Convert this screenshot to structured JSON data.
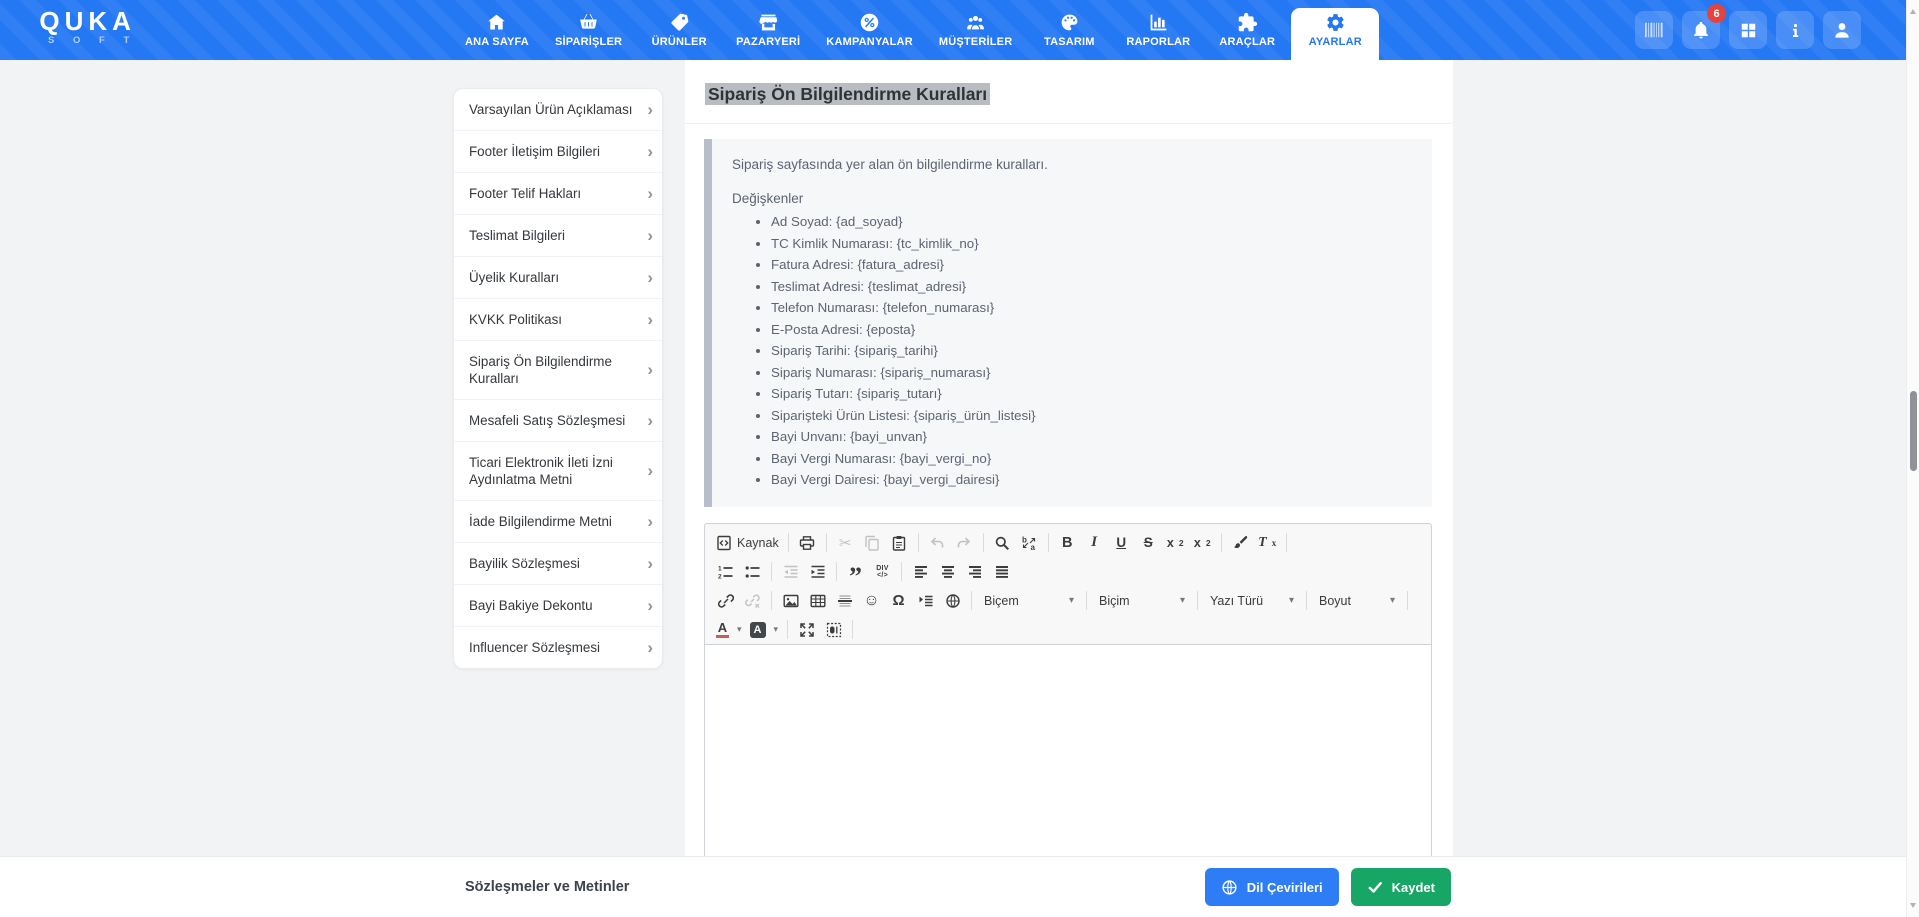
{
  "brand": {
    "name": "QUKA",
    "sub": "S O F T"
  },
  "colors": {
    "accent_blue": "#2277f2",
    "success_green": "#17a666",
    "badge_red": "#e5433e",
    "info_box_bar": "#b7bdca"
  },
  "header": {
    "notifications_badge": "6",
    "nav": [
      {
        "label": "ANA SAYFA",
        "icon": "home-icon",
        "active": false
      },
      {
        "label": "SİPARİŞLER",
        "icon": "basket-icon",
        "active": false
      },
      {
        "label": "ÜRÜNLER",
        "icon": "tag-icon",
        "active": false
      },
      {
        "label": "PAZARYERİ",
        "icon": "store-icon",
        "active": false
      },
      {
        "label": "KAMPANYALAR",
        "icon": "percent-icon",
        "active": false
      },
      {
        "label": "MÜŞTERİLER",
        "icon": "users-icon",
        "active": false
      },
      {
        "label": "TASARIM",
        "icon": "palette-icon",
        "active": false
      },
      {
        "label": "RAPORLAR",
        "icon": "chart-icon",
        "active": false
      },
      {
        "label": "ARAÇLAR",
        "icon": "puzzle-icon",
        "active": false
      },
      {
        "label": "AYARLAR",
        "icon": "gear-icon",
        "active": true
      }
    ],
    "actions": [
      {
        "icon": "barcode-icon"
      },
      {
        "icon": "bell-icon",
        "badge": "6"
      },
      {
        "icon": "grid-icon"
      },
      {
        "icon": "info-icon"
      },
      {
        "icon": "user-icon"
      }
    ]
  },
  "sidebar": {
    "items": [
      "Varsayılan Ürün Açıklaması",
      "Footer İletişim Bilgileri",
      "Footer Telif Hakları",
      "Teslimat Bilgileri",
      "Üyelik Kuralları",
      "KVKK Politikası",
      "Sipariş Ön Bilgilendirme Kuralları",
      "Mesafeli Satış Sözleşmesi",
      "Ticari Elektronik İleti İzni Aydınlatma Metni",
      "İade Bilgilendirme Metni",
      "Bayilik Sözleşmesi",
      "Bayi Bakiye Dekontu",
      "Influencer Sözleşmesi"
    ]
  },
  "content": {
    "title": "Sipariş Ön Bilgilendirme Kuralları",
    "info": {
      "intro": "Sipariş sayfasında yer alan ön bilgilendirme kuralları.",
      "variables_heading": "Değişkenler",
      "variables": [
        "Ad Soyad: {ad_soyad}",
        "TC Kimlik Numarası: {tc_kimlik_no}",
        "Fatura Adresi: {fatura_adresi}",
        "Teslimat Adresi: {teslimat_adresi}",
        "Telefon Numarası: {telefon_numarası}",
        "E-Posta Adresi: {eposta}",
        "Sipariş Tarihi: {sipariş_tarihi}",
        "Sipariş Numarası: {sipariş_numarası}",
        "Sipariş Tutarı: {sipariş_tutarı}",
        "Siparişteki Ürün Listesi: {sipariş_ürün_listesi}",
        "Bayi Unvanı: {bayi_unvan}",
        "Bayi Vergi Numarası: {bayi_vergi_no}",
        "Bayi Vergi Dairesi: {bayi_vergi_dairesi}"
      ]
    }
  },
  "editor": {
    "source_label": "Kaynak",
    "dropdowns": [
      "Biçem",
      "Biçim",
      "Yazı Türü",
      "Boyut"
    ],
    "glyphs": {
      "cut": "✂",
      "bold": "B",
      "italic": "I",
      "underline": "U",
      "strike": "S",
      "sub_base": "x",
      "sub_mark": "2",
      "sup_base": "x",
      "sup_mark": "2",
      "remove_t": "T",
      "remove_x": "x",
      "quote": "”",
      "div_top": "DIV",
      "div_bot": "</>",
      "smiley": "☺",
      "omega": "Ω",
      "color_a": "A",
      "bg_a": "A"
    }
  },
  "footer": {
    "title": "Sözleşmeler ve Metinler",
    "translate_label": "Dil Çevirileri",
    "save_label": "Kaydet"
  }
}
